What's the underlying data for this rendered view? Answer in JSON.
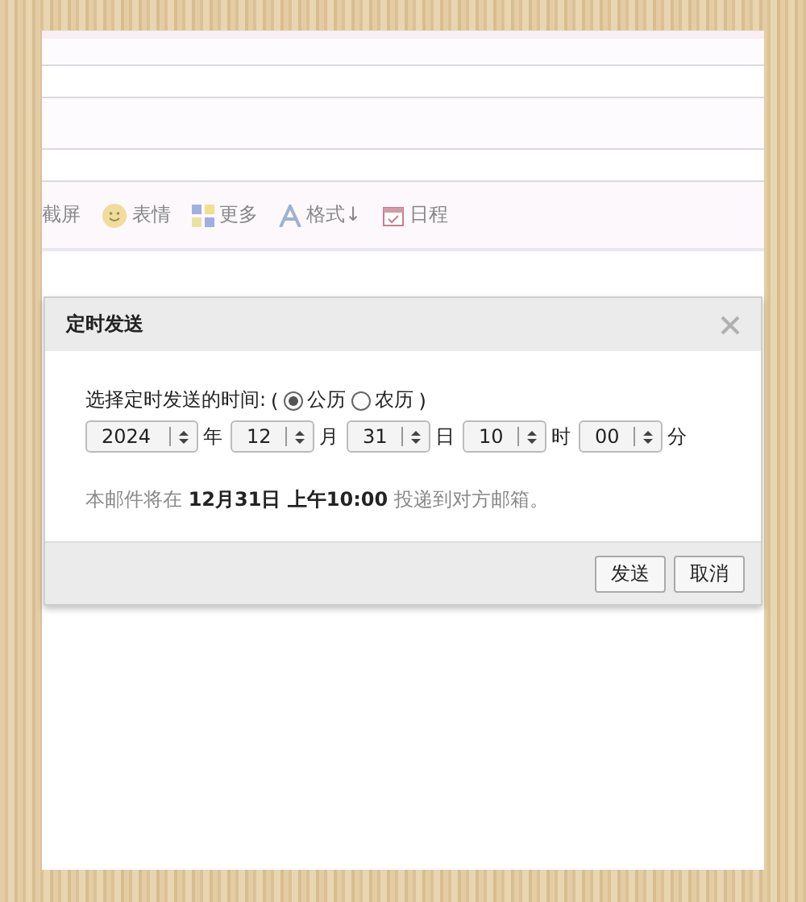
{
  "toolbar": {
    "items": [
      {
        "kind": "plain",
        "label": "截屏"
      },
      {
        "kind": "emoji",
        "label": "表情"
      },
      {
        "kind": "more",
        "label": "更多"
      },
      {
        "kind": "format",
        "label": "格式↓"
      },
      {
        "kind": "calendar",
        "label": "日程"
      }
    ]
  },
  "dialog": {
    "title": "定时发送",
    "prompt": "选择定时发送的时间:",
    "open_paren": "(",
    "close_paren": ")",
    "calendars": [
      {
        "label": "公历",
        "selected": true
      },
      {
        "label": "农历",
        "selected": false
      }
    ],
    "fields": [
      {
        "value": "2024",
        "unit": "年"
      },
      {
        "value": "12",
        "unit": "月"
      },
      {
        "value": "31",
        "unit": "日"
      },
      {
        "value": "10",
        "unit": "时"
      },
      {
        "value": "00",
        "unit": "分"
      }
    ],
    "summary": "本邮件将在 **12月31日 上午10:00** 投递到对方邮箱。",
    "buttons": [
      "发送",
      "取消"
    ]
  }
}
